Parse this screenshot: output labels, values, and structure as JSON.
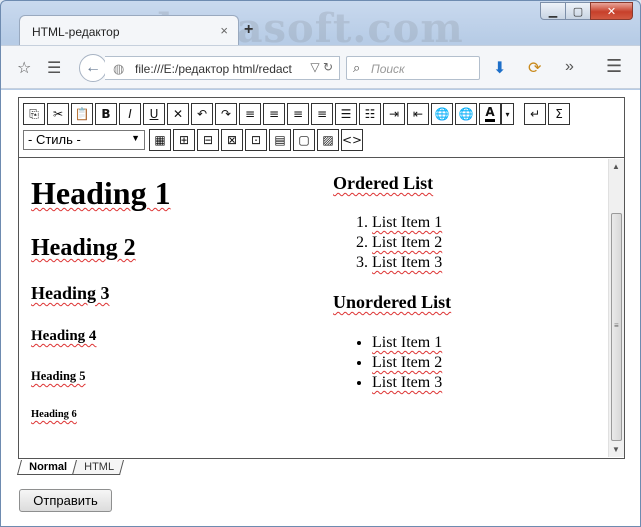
{
  "watermark": "sharasoft.com",
  "browser": {
    "tab_title": "HTML-редактор",
    "tab_close": "×",
    "new_tab": "+",
    "url": "file:///E:/редактор html/redact",
    "search_placeholder": "Поиск"
  },
  "toolbar": {
    "style_select": "- Стиль -",
    "row1": [
      {
        "name": "copy-button",
        "glyph": "⎘"
      },
      {
        "name": "cut-button",
        "glyph": "✂"
      },
      {
        "name": "paste-button",
        "glyph": "📋"
      },
      {
        "name": "bold-button",
        "glyph": "B"
      },
      {
        "name": "italic-button",
        "glyph": "I"
      },
      {
        "name": "underline-button",
        "glyph": "U"
      },
      {
        "name": "remove-format-button",
        "glyph": "✕"
      },
      {
        "name": "undo-button",
        "glyph": "↶"
      },
      {
        "name": "redo-button",
        "glyph": "↷"
      },
      {
        "name": "align-left-button",
        "glyph": "≡"
      },
      {
        "name": "align-center-button",
        "glyph": "≡"
      },
      {
        "name": "align-right-button",
        "glyph": "≡"
      },
      {
        "name": "align-justify-button",
        "glyph": "≡"
      },
      {
        "name": "unordered-list-button",
        "glyph": "☰"
      },
      {
        "name": "ordered-list-button",
        "glyph": "☷"
      },
      {
        "name": "indent-button",
        "glyph": "⇥"
      },
      {
        "name": "outdent-button",
        "glyph": "⇤"
      },
      {
        "name": "insert-link-button",
        "glyph": "🌐"
      },
      {
        "name": "remove-link-button",
        "glyph": "🌐"
      },
      {
        "name": "text-color-button",
        "glyph": "A"
      },
      {
        "name": "text-color-dropdown",
        "glyph": "▾"
      },
      {
        "name": "line-break-button",
        "glyph": "↵"
      },
      {
        "name": "special-chars-button",
        "glyph": "Σ"
      }
    ],
    "row2": [
      {
        "name": "insert-table-button",
        "glyph": "▦"
      },
      {
        "name": "insert-row-button",
        "glyph": "⊞"
      },
      {
        "name": "insert-column-button",
        "glyph": "⊟"
      },
      {
        "name": "delete-row-button",
        "glyph": "⊠"
      },
      {
        "name": "delete-column-button",
        "glyph": "⊡"
      },
      {
        "name": "insert-form-button",
        "glyph": "▤"
      },
      {
        "name": "insert-box-button",
        "glyph": "▢"
      },
      {
        "name": "insert-image-button",
        "glyph": "▨"
      },
      {
        "name": "source-code-button",
        "glyph": "<>"
      }
    ]
  },
  "document": {
    "headings": [
      "Heading 1",
      "Heading 2",
      "Heading 3",
      "Heading 4",
      "Heading 5",
      "Heading 6"
    ],
    "ordered_title": "Ordered List",
    "ordered_items": [
      "List Item 1",
      "List Item 2",
      "List Item 3"
    ],
    "unordered_title": "Unordered List",
    "unordered_items": [
      "List Item 1",
      "List Item 2",
      "List Item 3"
    ]
  },
  "modes": [
    "Normal",
    "HTML"
  ],
  "submit_label": "Отправить",
  "colors": {
    "window_frame": "#b7cce6",
    "spellcheck": "#dd3333",
    "close_button": "#c7402b"
  }
}
